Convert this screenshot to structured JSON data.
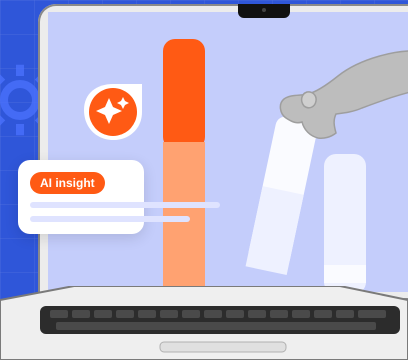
{
  "insight_card": {
    "label": "AI insight"
  },
  "icons": {
    "sparkle_badge": "sparkle-icon",
    "background_gear": "gear-icon"
  },
  "colors": {
    "background": "#2f56d9",
    "screen": "#c4cdfb",
    "accent": "#ff5a14",
    "accent_light": "#ffa271",
    "bar_pale": "#eef1ff"
  }
}
